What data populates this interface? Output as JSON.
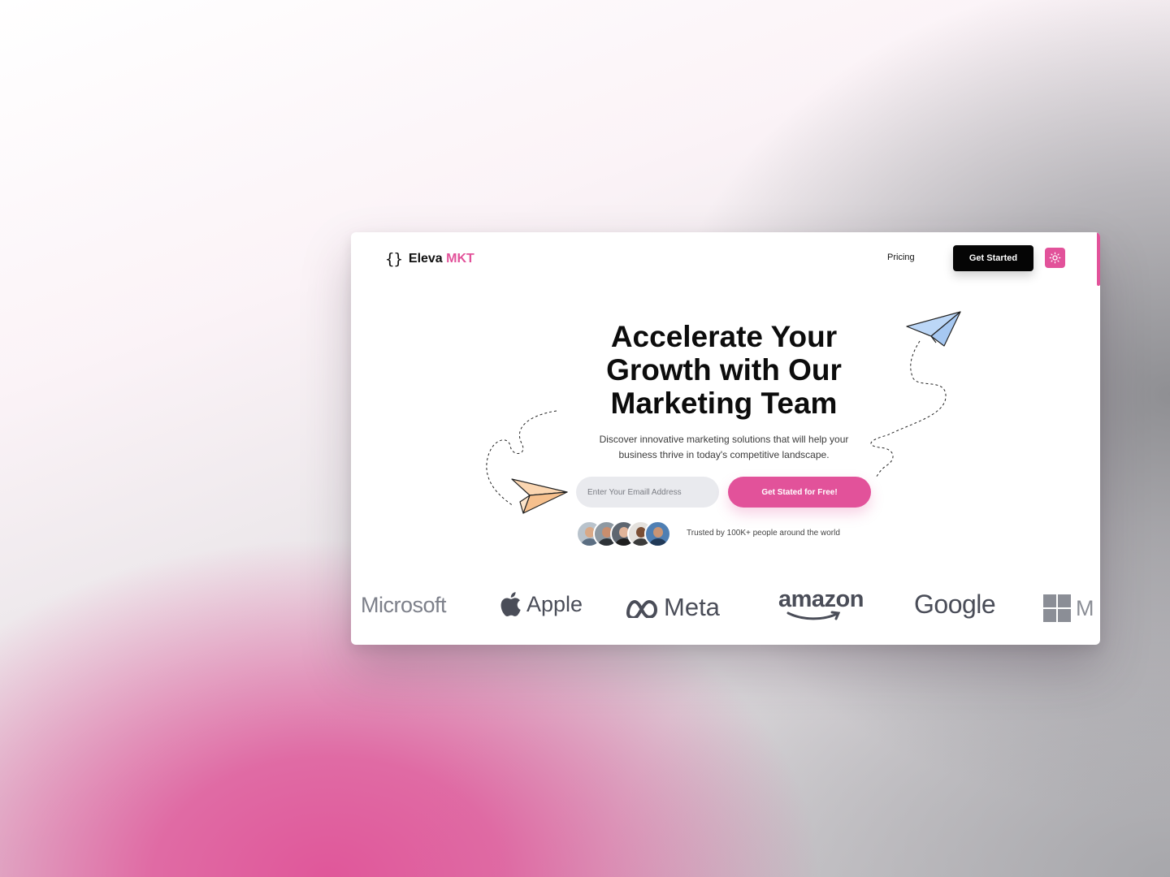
{
  "brand": {
    "name": "Eleva",
    "accent": "MKT",
    "braces": "{}"
  },
  "nav": {
    "pricing": "Pricing",
    "get_started": "Get Started",
    "theme_icon": "sun-icon"
  },
  "hero": {
    "title_lines": [
      "Accelerate Your",
      "Growth with Our",
      "Marketing Team"
    ],
    "subtitle_lines": [
      "Discover innovative marketing solutions that will help your",
      "business thrive in today's competitive landscape."
    ],
    "email_placeholder": "Enter Your Emaill Address",
    "cta": "Get Stated for Free!",
    "trusted": "Trusted by 100K+ people around the world"
  },
  "logos": {
    "microsoft": "Microsoft",
    "apple": "Apple",
    "meta": "Meta",
    "amazon": "amazon",
    "google": "Google",
    "microsoft_partial": "M"
  },
  "colors": {
    "accent": "#e2529a",
    "dark": "#050505",
    "logo_gray": "#4a4d58"
  }
}
